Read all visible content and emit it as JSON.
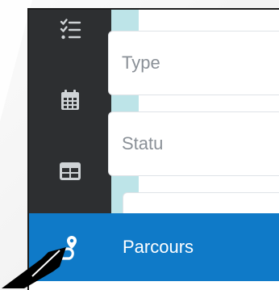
{
  "sidebar": {
    "icons": [
      {
        "name": "tasks-icon"
      },
      {
        "name": "calendar-icon"
      },
      {
        "name": "table-icon"
      }
    ],
    "active_item": {
      "label": "Parcours",
      "icon": "route-icon"
    }
  },
  "main": {
    "fields": [
      {
        "placeholder": "Type"
      },
      {
        "placeholder": "Statu"
      },
      {
        "placeholder": ""
      }
    ]
  },
  "colors": {
    "sidebar_bg": "#2d2f31",
    "accent_strip": "#bde4e8",
    "active_bg": "#0f7ac8",
    "active_text": "#ffffff"
  }
}
